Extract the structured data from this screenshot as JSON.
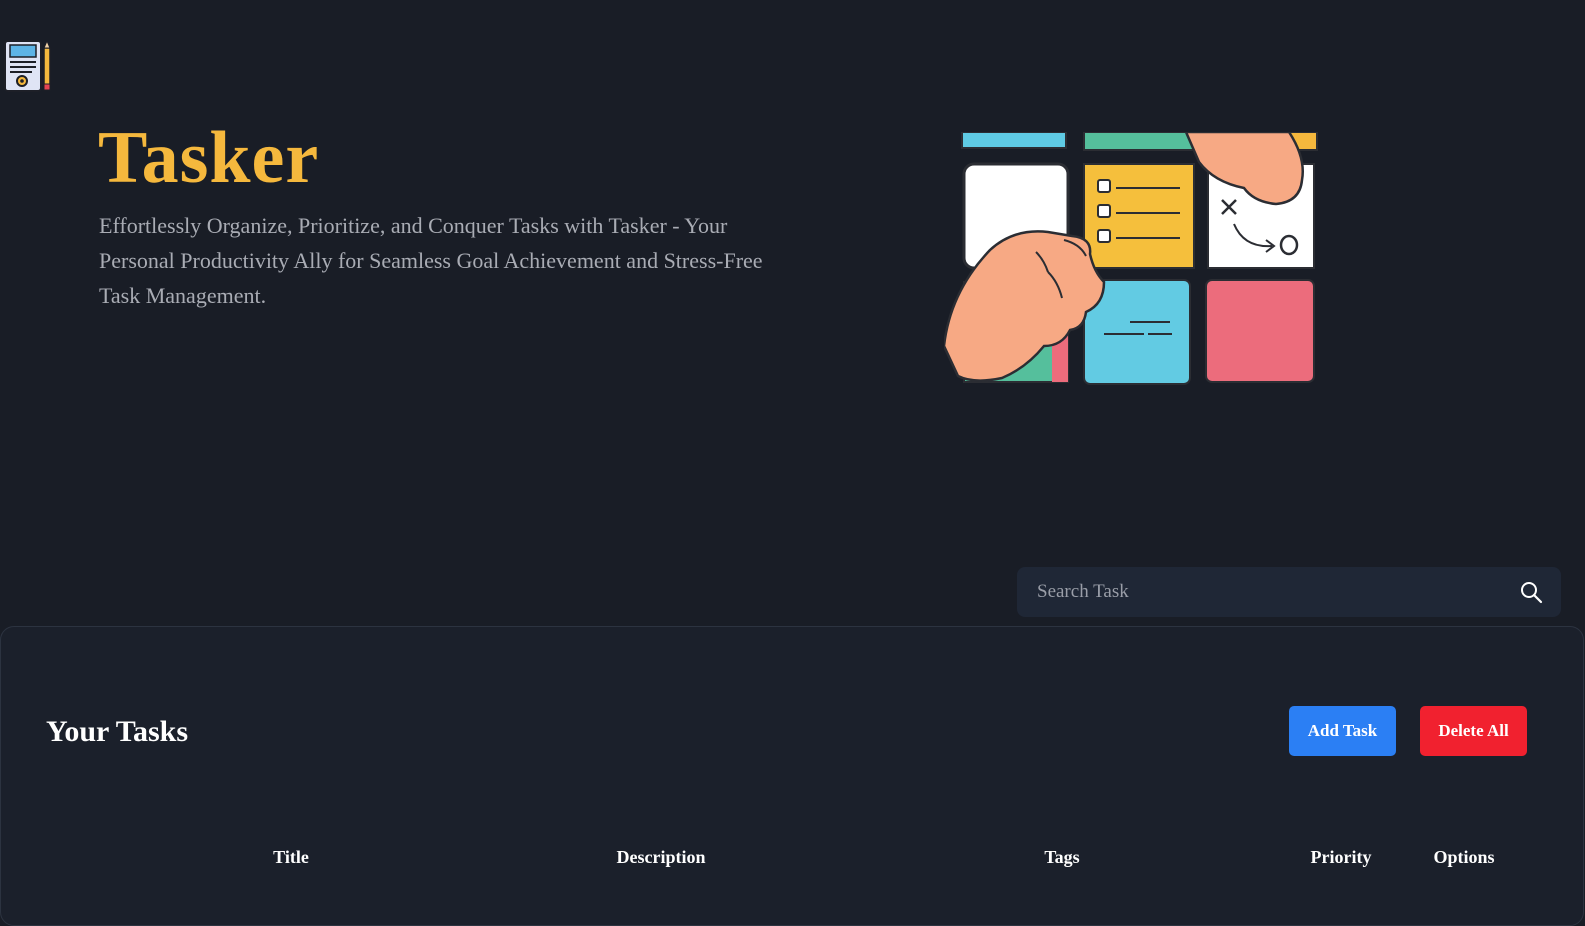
{
  "app": {
    "logo_icon": "task-notepad-pencil-icon",
    "title": "Tasker",
    "subtitle": "Effortlessly Organize, Prioritize, and Conquer Tasks with Tasker - Your Personal Productivity Ally for Seamless Goal Achievement and Stress-Free Task Management.",
    "hero_image": "sticky-notes-hands-illustration"
  },
  "search": {
    "placeholder": "Search Task",
    "value": "",
    "icon": "search-icon"
  },
  "tasks": {
    "heading": "Your Tasks",
    "add_label": "Add Task",
    "delete_all_label": "Delete All",
    "columns": [
      "Title",
      "Description",
      "Tags",
      "Priority",
      "Options"
    ]
  },
  "colors": {
    "background": "#191d26",
    "accent": "#f5b83d",
    "add_button": "#2b7ff4",
    "delete_button": "#f1212f"
  }
}
